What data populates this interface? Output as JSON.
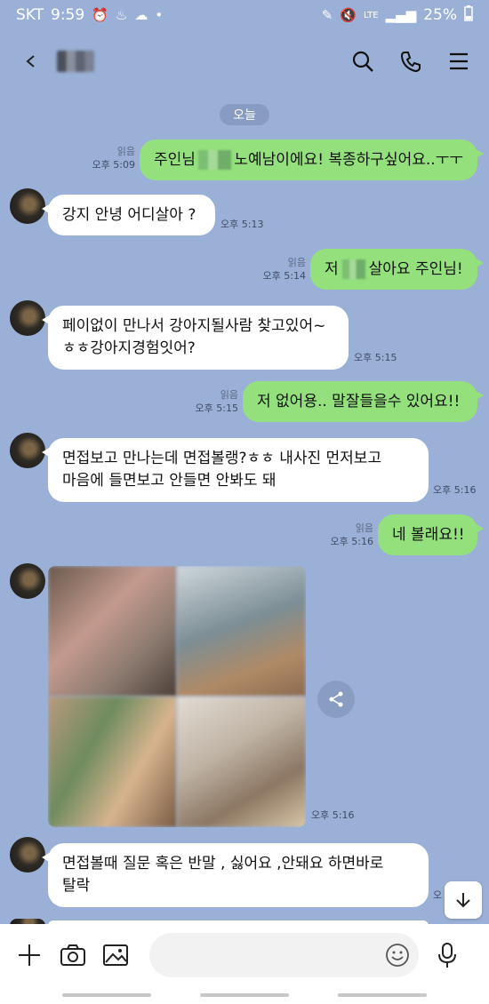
{
  "status": {
    "carrier": "SKT",
    "time": "9:59",
    "battery": "25%",
    "network": "LTE"
  },
  "header": {
    "back": "back",
    "icons": [
      "search-icon",
      "phone-icon",
      "menu-icon"
    ]
  },
  "date_badge": "오늘",
  "messages": [
    {
      "dir": "out",
      "read": "읽음",
      "time": "오후 5:09",
      "text_before": "주인님",
      "text_after": "노예남이에요! 복종하구싶어요..ㅜㅜ"
    },
    {
      "dir": "in",
      "time": "오후 5:13",
      "text": "강지 안녕 어디살아 ?"
    },
    {
      "dir": "out",
      "read": "읽음",
      "time": "오후 5:14",
      "text_before": "저",
      "text_after": "살아요 주인님!"
    },
    {
      "dir": "in",
      "time": "오후 5:15",
      "lines": [
        "페이없이 만나서 강아지될사람 찾고있어~",
        "ㅎㅎ강아지경험잇어?"
      ]
    },
    {
      "dir": "out",
      "read": "읽음",
      "time": "오후 5:15",
      "text": "저 없어용..  말잘들을수 있어요!!"
    },
    {
      "dir": "in",
      "time": "오후 5:16",
      "lines": [
        "면접보고 만나는데 면접볼랭?ㅎㅎ 내사진 먼저보고",
        "마음에 들면보고 안들면 안봐도 돼"
      ]
    },
    {
      "dir": "out",
      "read": "읽음",
      "time": "오후 5:16",
      "text": "네 볼래요!!"
    },
    {
      "dir": "in",
      "time": "오후 5:16",
      "type": "photo"
    },
    {
      "dir": "in",
      "time": "오",
      "lines": [
        "면접볼때 질문 혹은 반말 , 싫어요 ,안돼요 하면바로",
        "탈락"
      ]
    }
  ],
  "input": {
    "placeholder": ""
  }
}
